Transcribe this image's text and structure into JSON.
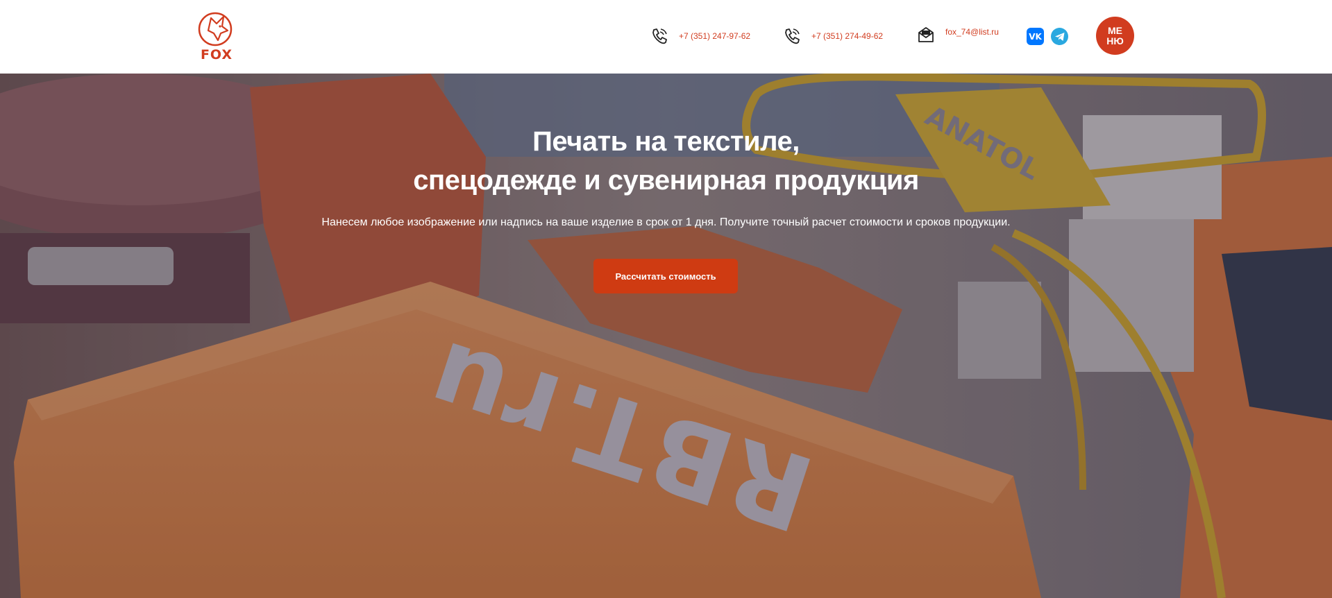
{
  "header": {
    "logo_text": "FOX",
    "phone1": "+7 (351) 247-97-62",
    "phone2": "+7 (351) 274-49-62",
    "email": "fox_74@list.ru",
    "vk_label": "VK",
    "menu_label": "МЕНЮ"
  },
  "hero": {
    "title_line1": "Печать на текстиле,",
    "title_line2": "спецодежде и сувенирная продукция",
    "subtitle": "Нанесем любое изображение или надпись на ваше изделие в срок от 1 дня. Получите точный расчет стоимости и сроков продукции.",
    "cta_label": "Рассчитать стоимость",
    "photo_print_text": "RBT.ru",
    "photo_machine_text": "ANATOL"
  },
  "colors": {
    "accent": "#d13c1f",
    "cta": "#cf3b12",
    "vk": "#0077ff",
    "telegram": "#2aa8e0"
  },
  "icons": [
    "fox-logo-icon",
    "phone-icon",
    "mail-icon",
    "vk-icon",
    "telegram-icon"
  ]
}
